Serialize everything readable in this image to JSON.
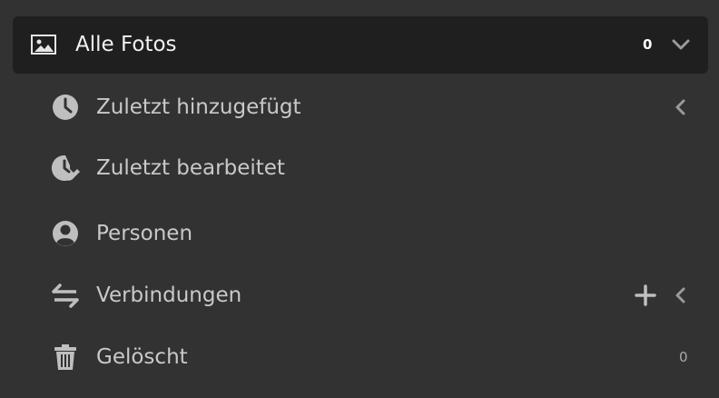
{
  "top": {
    "label": "Alle Fotos",
    "count": "0",
    "icon": "photos-icon",
    "chevron": "chevron-down-icon"
  },
  "items": [
    {
      "label": "Zuletzt hinzugefügt",
      "icon": "clock-icon",
      "chevron": "chevron-left-icon"
    },
    {
      "label": "Zuletzt bearbeitet",
      "icon": "clock-edit-icon"
    },
    {
      "label": "Personen",
      "icon": "person-icon"
    },
    {
      "label": "Verbindungen",
      "icon": "connections-icon",
      "add": "plus-icon",
      "chevron": "chevron-left-icon"
    },
    {
      "label": "Gelöscht",
      "icon": "trash-icon",
      "count": "0"
    }
  ],
  "colors": {
    "background": "#323232",
    "selected_background": "#1f1f1f",
    "icon": "#bfbfbf",
    "text": "#c9c9c9",
    "selected_text": "#f2f2f2"
  }
}
